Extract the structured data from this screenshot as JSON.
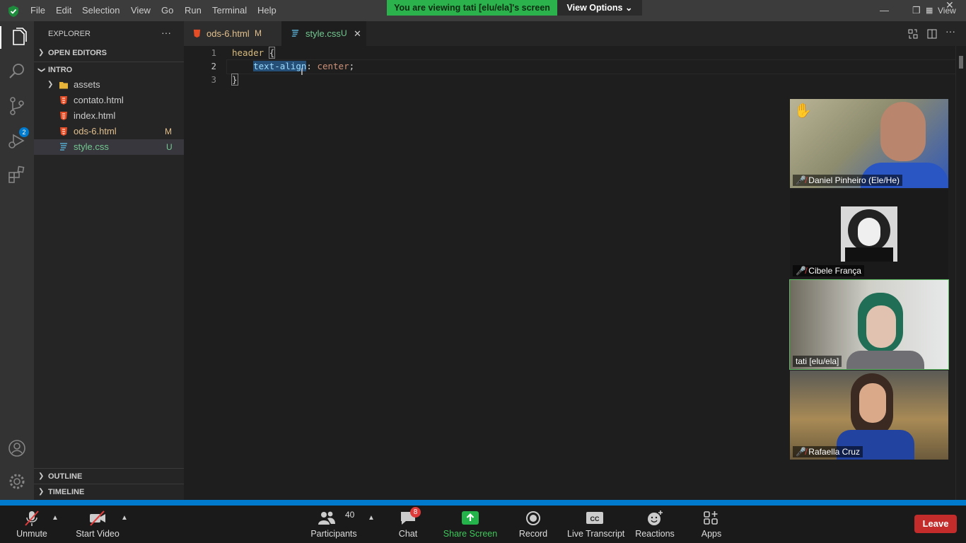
{
  "menu": [
    "File",
    "Edit",
    "Selection",
    "View",
    "Go",
    "Run",
    "Terminal",
    "Help"
  ],
  "share_banner": "You are viewing tati [elu/ela]'s screen",
  "view_options": "View Options",
  "window_view_label": "View",
  "sidebar": {
    "title": "EXPLORER",
    "more": "···",
    "open_editors": "OPEN EDITORS",
    "folder": "INTRO",
    "items": [
      {
        "label": "assets",
        "type": "folder",
        "status": ""
      },
      {
        "label": "contato.html",
        "type": "html",
        "status": ""
      },
      {
        "label": "index.html",
        "type": "html",
        "status": ""
      },
      {
        "label": "ods-6.html",
        "type": "html",
        "status": "M"
      },
      {
        "label": "style.css",
        "type": "css",
        "status": "U"
      }
    ],
    "outline": "OUTLINE",
    "timeline": "TIMELINE"
  },
  "tabs": [
    {
      "label": "ods-6.html",
      "status": "M"
    },
    {
      "label": "style.css",
      "status": "U"
    }
  ],
  "editor": {
    "lines": [
      {
        "num": "1",
        "text": "header {"
      },
      {
        "num": "2",
        "text": "    text-align: center;"
      },
      {
        "num": "3",
        "text": "}"
      }
    ],
    "current_line": "2"
  },
  "activity_badge": "2",
  "participants": [
    {
      "name": "Daniel Pinheiro (Ele/He)",
      "muted": true,
      "hand_raised": true
    },
    {
      "name": "Cibele França",
      "muted": true,
      "hand_raised": false
    },
    {
      "name": "tati [elu/ela]",
      "muted": false,
      "hand_raised": false
    },
    {
      "name": "Rafaella Cruz",
      "muted": true,
      "hand_raised": false
    }
  ],
  "zoom_toolbar": {
    "unmute": "Unmute",
    "start_video": "Start Video",
    "participants": "Participants",
    "participants_count": "40",
    "chat": "Chat",
    "chat_badge": "8",
    "share_screen": "Share Screen",
    "record": "Record",
    "live_transcript": "Live Transcript",
    "reactions": "Reactions",
    "apps": "Apps",
    "leave": "Leave"
  },
  "colors": {
    "accent": "#007acc",
    "modified": "#e2c08d",
    "untracked": "#73c991",
    "share_green": "#2bb24c",
    "leave_red": "#c42b2b"
  }
}
